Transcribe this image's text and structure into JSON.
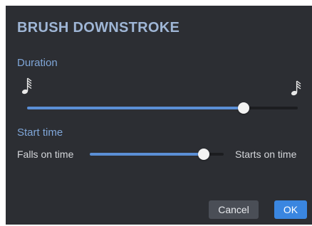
{
  "dialog": {
    "title": "BRUSH DOWNSTROKE"
  },
  "duration": {
    "label": "Duration",
    "left_icon": "sixty-fourth-note-icon",
    "right_icon": "thirty-second-note-icon",
    "value_fraction": 0.8
  },
  "start_time": {
    "label": "Start time",
    "min_label": "Falls on time",
    "max_label": "Starts on time",
    "value_fraction": 0.85
  },
  "buttons": {
    "cancel": "Cancel",
    "ok": "OK"
  },
  "colors": {
    "background": "#2c2e33",
    "title": "#9fb6d6",
    "section_label": "#7fa6d8",
    "slider_fill": "#5b8fd6",
    "ok_button": "#3a86e0"
  }
}
